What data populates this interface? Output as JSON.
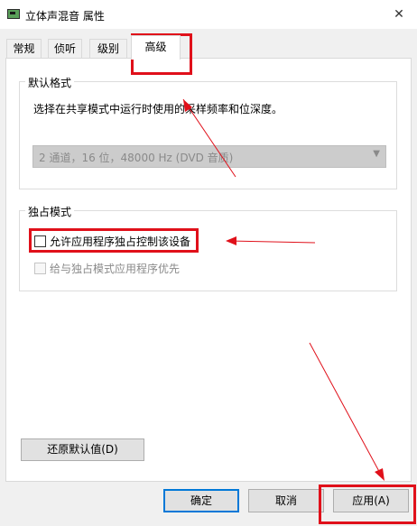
{
  "window": {
    "title": "立体声混音 属性",
    "close_glyph": "✕"
  },
  "tabs": [
    {
      "label": "常规"
    },
    {
      "label": "侦听"
    },
    {
      "label": "级别"
    },
    {
      "label": "高级"
    }
  ],
  "default_format": {
    "legend": "默认格式",
    "description": "选择在共享模式中运行时使用的采样频率和位深度。",
    "selected_value": "2 通道，16 位，48000 Hz (DVD 音质)"
  },
  "exclusive_mode": {
    "legend": "独占模式",
    "allow_exclusive_label": "允许应用程序独占控制该设备",
    "priority_label": "给与独占模式应用程序优先"
  },
  "buttons": {
    "restore_defaults": "还原默认值(D)",
    "ok": "确定",
    "cancel": "取消",
    "apply": "应用(A)"
  },
  "annotation_color": "#e0101a"
}
